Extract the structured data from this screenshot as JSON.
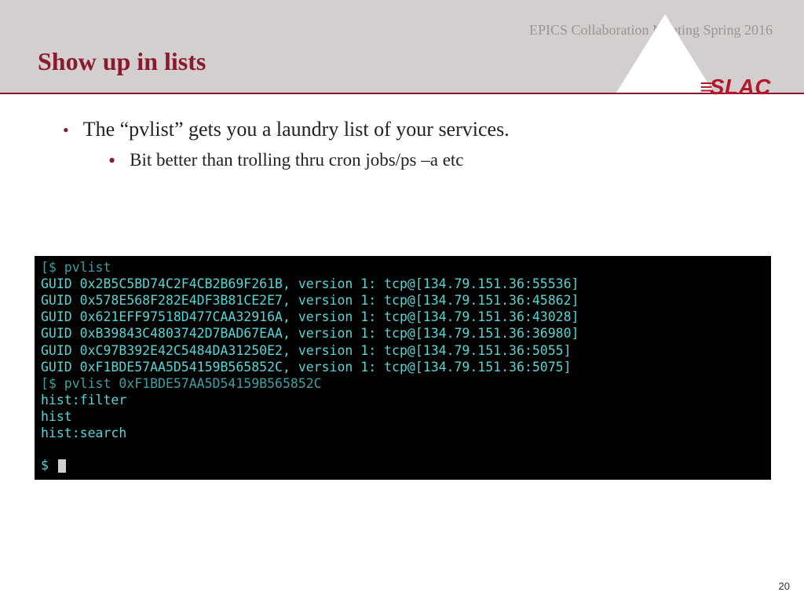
{
  "header": {
    "event": "EPICS Collaboration Meeting Spring 2016",
    "title": "Show up in lists",
    "logo_text": "SLAC"
  },
  "bullets": {
    "l1": "The “pvlist” gets you a laundry list of your services.",
    "l2": "Bit better than trolling thru cron jobs/ps –a etc"
  },
  "terminal": {
    "lines": [
      {
        "class": "dim",
        "text": "[$ pvlist"
      },
      {
        "class": "",
        "text": "GUID 0x2B5C5BD74C2F4CB2B69F261B, version 1: tcp@[134.79.151.36:55536]"
      },
      {
        "class": "",
        "text": "GUID 0x578E568F282E4DF3B81CE2E7, version 1: tcp@[134.79.151.36:45862]"
      },
      {
        "class": "",
        "text": "GUID 0x621EFF97518D477CAA32916A, version 1: tcp@[134.79.151.36:43028]"
      },
      {
        "class": "",
        "text": "GUID 0xB39843C4803742D7BAD67EAA, version 1: tcp@[134.79.151.36:36980]"
      },
      {
        "class": "",
        "text": "GUID 0xC97B392E42C5484DA31250E2, version 1: tcp@[134.79.151.36:5055]"
      },
      {
        "class": "",
        "text": "GUID 0xF1BDE57AA5D54159B565852C, version 1: tcp@[134.79.151.36:5075]"
      },
      {
        "class": "dim",
        "text": "[$ pvlist 0xF1BDE57AA5D54159B565852C"
      },
      {
        "class": "",
        "text": "hist:filter"
      },
      {
        "class": "",
        "text": "hist"
      },
      {
        "class": "",
        "text": "hist:search"
      }
    ],
    "prompt": "$ "
  },
  "page_number": "20"
}
